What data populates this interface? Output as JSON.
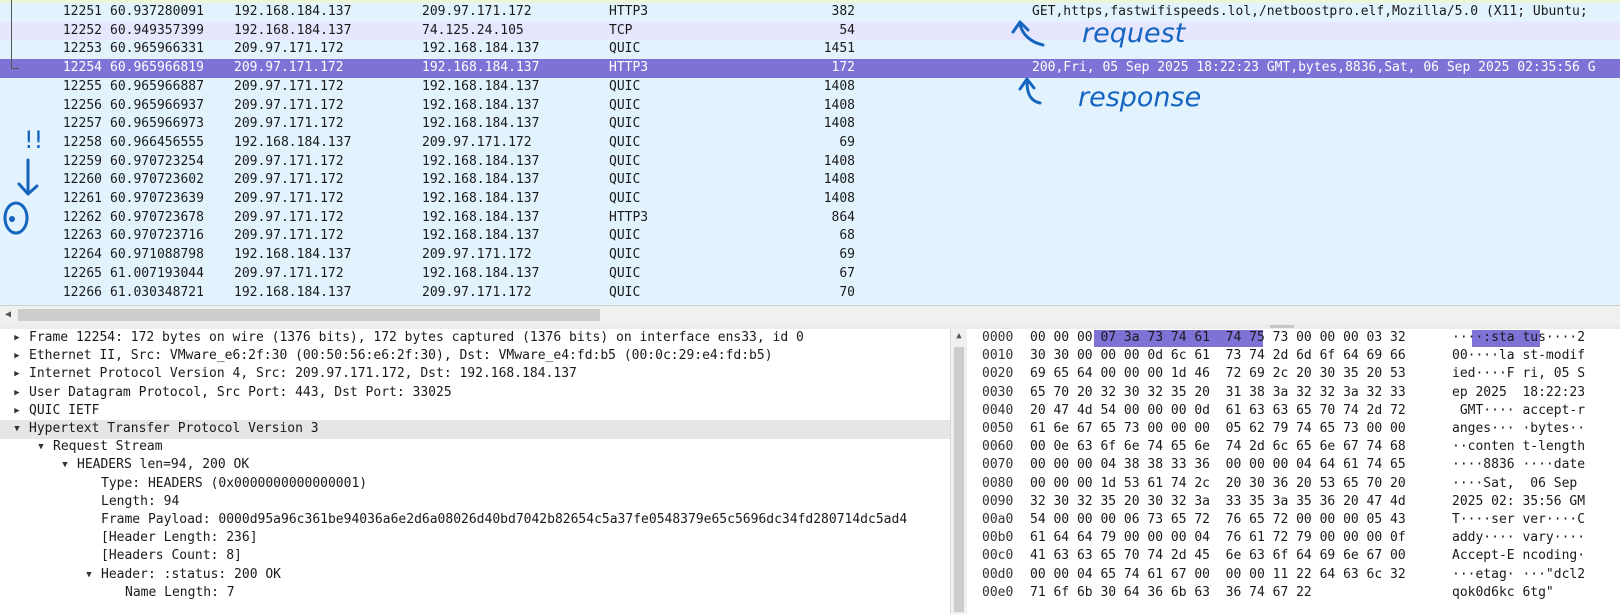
{
  "packets": [
    {
      "no": "12251",
      "time": "60.937280091",
      "src": "192.168.184.137",
      "dst": "209.97.171.172",
      "proto": "HTTP3",
      "len": "382",
      "info": "GET,https,fastwifispeeds.lol,/netboostpro.elf,Mozilla/5.0 (X11; Ubuntu;"
    },
    {
      "no": "12252",
      "time": "60.949357399",
      "src": "192.168.184.137",
      "dst": "74.125.24.105",
      "proto": "TCP",
      "len": "54",
      "info": ""
    },
    {
      "no": "12253",
      "time": "60.965966331",
      "src": "209.97.171.172",
      "dst": "192.168.184.137",
      "proto": "QUIC",
      "len": "1451",
      "info": ""
    },
    {
      "no": "12254",
      "time": "60.965966819",
      "src": "209.97.171.172",
      "dst": "192.168.184.137",
      "proto": "HTTP3",
      "len": "172",
      "info": "200,Fri, 05 Sep 2025 18:22:23 GMT,bytes,8836,Sat, 06 Sep 2025 02:35:56 G"
    },
    {
      "no": "12255",
      "time": "60.965966887",
      "src": "209.97.171.172",
      "dst": "192.168.184.137",
      "proto": "QUIC",
      "len": "1408",
      "info": ""
    },
    {
      "no": "12256",
      "time": "60.965966937",
      "src": "209.97.171.172",
      "dst": "192.168.184.137",
      "proto": "QUIC",
      "len": "1408",
      "info": ""
    },
    {
      "no": "12257",
      "time": "60.965966973",
      "src": "209.97.171.172",
      "dst": "192.168.184.137",
      "proto": "QUIC",
      "len": "1408",
      "info": ""
    },
    {
      "no": "12258",
      "time": "60.966456555",
      "src": "192.168.184.137",
      "dst": "209.97.171.172",
      "proto": "QUIC",
      "len": "69",
      "info": ""
    },
    {
      "no": "12259",
      "time": "60.970723254",
      "src": "209.97.171.172",
      "dst": "192.168.184.137",
      "proto": "QUIC",
      "len": "1408",
      "info": ""
    },
    {
      "no": "12260",
      "time": "60.970723602",
      "src": "209.97.171.172",
      "dst": "192.168.184.137",
      "proto": "QUIC",
      "len": "1408",
      "info": ""
    },
    {
      "no": "12261",
      "time": "60.970723639",
      "src": "209.97.171.172",
      "dst": "192.168.184.137",
      "proto": "QUIC",
      "len": "1408",
      "info": ""
    },
    {
      "no": "12262",
      "time": "60.970723678",
      "src": "209.97.171.172",
      "dst": "192.168.184.137",
      "proto": "HTTP3",
      "len": "864",
      "info": ""
    },
    {
      "no": "12263",
      "time": "60.970723716",
      "src": "209.97.171.172",
      "dst": "192.168.184.137",
      "proto": "QUIC",
      "len": "68",
      "info": ""
    },
    {
      "no": "12264",
      "time": "60.971088798",
      "src": "192.168.184.137",
      "dst": "209.97.171.172",
      "proto": "QUIC",
      "len": "69",
      "info": ""
    },
    {
      "no": "12265",
      "time": "61.007193044",
      "src": "209.97.171.172",
      "dst": "192.168.184.137",
      "proto": "QUIC",
      "len": "67",
      "info": ""
    },
    {
      "no": "12266",
      "time": "61.030348721",
      "src": "192.168.184.137",
      "dst": "209.97.171.172",
      "proto": "QUIC",
      "len": "70",
      "info": ""
    }
  ],
  "annotations": {
    "request": "request",
    "response": "response",
    "exclaim": "!!"
  },
  "tree": [
    {
      "text": "Frame 12254: 172 bytes on wire (1376 bits), 172 bytes captured (1376 bits) on interface ens33, id 0",
      "level": 0,
      "state": "collapsed"
    },
    {
      "text": "Ethernet II, Src: VMware_e6:2f:30 (00:50:56:e6:2f:30), Dst: VMware_e4:fd:b5 (00:0c:29:e4:fd:b5)",
      "level": 0,
      "state": "collapsed"
    },
    {
      "text": "Internet Protocol Version 4, Src: 209.97.171.172, Dst: 192.168.184.137",
      "level": 0,
      "state": "collapsed"
    },
    {
      "text": "User Datagram Protocol, Src Port: 443, Dst Port: 33025",
      "level": 0,
      "state": "collapsed"
    },
    {
      "text": "QUIC IETF",
      "level": 0,
      "state": "collapsed"
    },
    {
      "text": "Hypertext Transfer Protocol Version 3",
      "level": 0,
      "state": "expanded"
    },
    {
      "text": "Request Stream",
      "level": 1,
      "state": "expanded"
    },
    {
      "text": "HEADERS len=94, 200 OK",
      "level": 2,
      "state": "expanded"
    },
    {
      "text": "Type: HEADERS (0x0000000000000001)",
      "level": 3,
      "state": "leaf"
    },
    {
      "text": "Length: 94",
      "level": 3,
      "state": "leaf"
    },
    {
      "text": "Frame Payload: 0000d95a96c361be94036a6e2d6a08026d40bd7042b82654c5a37fe0548379e65c5696dc34fd280714dc5ad4",
      "level": 3,
      "state": "leaf"
    },
    {
      "text": "[Header Length: 236]",
      "level": 3,
      "state": "leaf"
    },
    {
      "text": "[Headers Count: 8]",
      "level": 3,
      "state": "leaf"
    },
    {
      "text": "Header: :status: 200 OK",
      "level": 3,
      "state": "expanded"
    },
    {
      "text": "Name Length: 7",
      "level": 4,
      "state": "leaf"
    }
  ],
  "hex": [
    {
      "off": "0000",
      "bytes": "00 00 00 07 3a 73 74 61  74 75 73 00 00 00 03 32",
      "ascii": "····:sta tus····2"
    },
    {
      "off": "0010",
      "bytes": "30 30 00 00 00 0d 6c 61  73 74 2d 6d 6f 64 69 66",
      "ascii": "00····la st-modif"
    },
    {
      "off": "0020",
      "bytes": "69 65 64 00 00 00 1d 46  72 69 2c 20 30 35 20 53",
      "ascii": "ied····F ri, 05 S"
    },
    {
      "off": "0030",
      "bytes": "65 70 20 32 30 32 35 20  31 38 3a 32 32 3a 32 33",
      "ascii": "ep 2025  18:22:23"
    },
    {
      "off": "0040",
      "bytes": "20 47 4d 54 00 00 00 0d  61 63 63 65 70 74 2d 72",
      "ascii": " GMT···· accept-r"
    },
    {
      "off": "0050",
      "bytes": "61 6e 67 65 73 00 00 00  05 62 79 74 65 73 00 00",
      "ascii": "anges··· ·bytes··"
    },
    {
      "off": "0060",
      "bytes": "00 0e 63 6f 6e 74 65 6e  74 2d 6c 65 6e 67 74 68",
      "ascii": "··conten t-length"
    },
    {
      "off": "0070",
      "bytes": "00 00 00 04 38 38 33 36  00 00 00 04 64 61 74 65",
      "ascii": "····8836 ····date"
    },
    {
      "off": "0080",
      "bytes": "00 00 00 1d 53 61 74 2c  20 30 36 20 53 65 70 20",
      "ascii": "····Sat,  06 Sep "
    },
    {
      "off": "0090",
      "bytes": "32 30 32 35 20 30 32 3a  33 35 3a 35 36 20 47 4d",
      "ascii": "2025 02: 35:56 GM"
    },
    {
      "off": "00a0",
      "bytes": "54 00 00 00 06 73 65 72  76 65 72 00 00 00 05 43",
      "ascii": "T····ser ver····C"
    },
    {
      "off": "00b0",
      "bytes": "61 64 64 79 00 00 00 04  76 61 72 79 00 00 00 0f",
      "ascii": "addy···· vary····"
    },
    {
      "off": "00c0",
      "bytes": "41 63 63 65 70 74 2d 45  6e 63 6f 64 69 6e 67 00",
      "ascii": "Accept-E ncoding·"
    },
    {
      "off": "00d0",
      "bytes": "00 00 04 65 74 61 67 00  00 00 11 22 64 63 6c 32",
      "ascii": "···etag· ···\"dcl2"
    },
    {
      "off": "00e0",
      "bytes": "71 6f 6b 30 64 36 6b 63  36 74 67 22",
      "ascii": "qok0d6kc 6tg\""
    }
  ],
  "colors": {
    "selected": "#7f72d6",
    "quic_bg": "#e2f3fe",
    "tcp_bg": "#e7e6ff",
    "annotation": "#1565c0"
  },
  "icons": {
    "expanded": "triangle-down",
    "collapsed": "triangle-right",
    "scroll_left": "arrow-left",
    "scroll_up": "arrow-up"
  }
}
